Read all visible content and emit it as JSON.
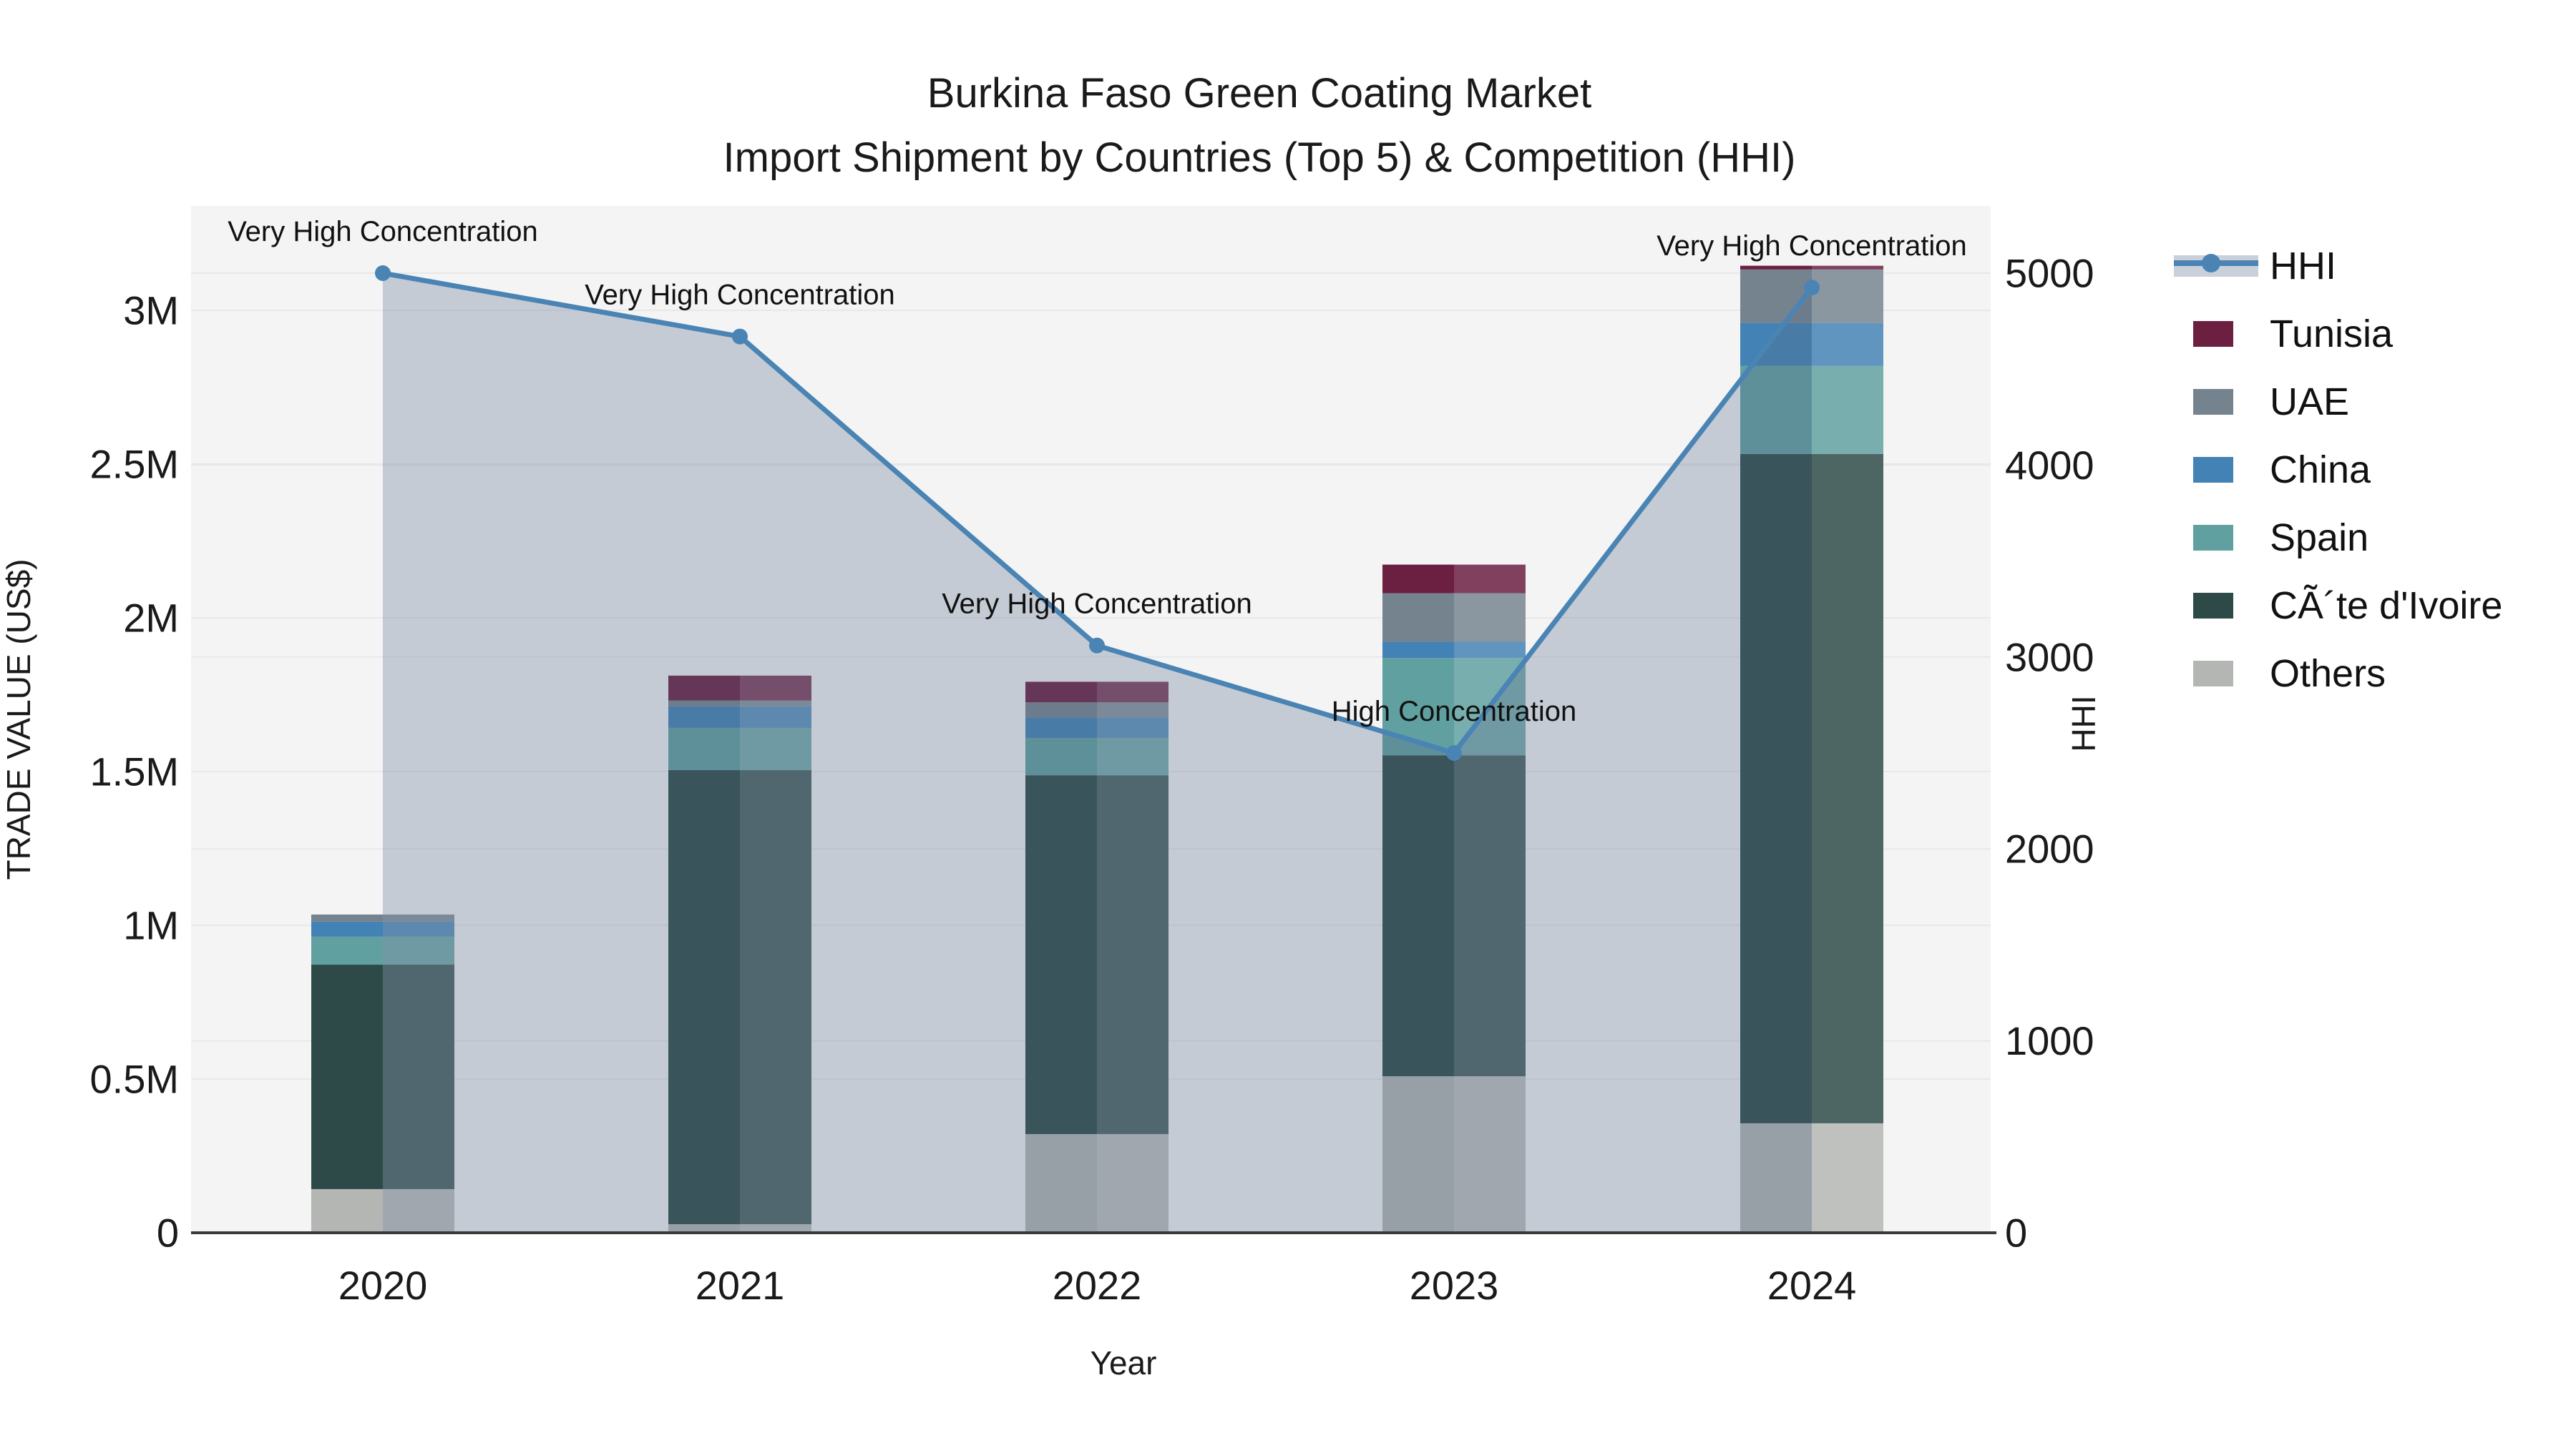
{
  "title": {
    "line1": "Burkina Faso Green Coating Market",
    "line2": "Import Shipment by Countries (Top 5) & Competition (HHI)"
  },
  "chart_data": {
    "type": "bar+line",
    "subtype": "stacked bars (trade value, left axis) with HHI line + area fill (right axis)",
    "categories": [
      "2020",
      "2021",
      "2022",
      "2023",
      "2024"
    ],
    "unit": "US$ millions",
    "stack_order_bottom_to_top": [
      "Others",
      "CÃ´te d'Ivoire",
      "Spain",
      "China",
      "UAE",
      "Tunisia"
    ],
    "series": [
      {
        "name": "Tunisia",
        "color": "#6b1f41",
        "values": [
          0,
          0.081,
          0.067,
          0.093,
          0.012
        ]
      },
      {
        "name": "UAE",
        "color": "#75838f",
        "values": [
          0.023,
          0.019,
          0.049,
          0.158,
          0.174
        ]
      },
      {
        "name": "China",
        "color": "#4382b4",
        "values": [
          0.049,
          0.07,
          0.067,
          0.053,
          0.14
        ]
      },
      {
        "name": "Spain",
        "color": "#61a0a0",
        "values": [
          0.091,
          0.137,
          0.121,
          0.316,
          0.286
        ]
      },
      {
        "name": "CÃ´te d'Ivoire",
        "color": "#2d4a48",
        "values": [
          0.73,
          1.477,
          1.167,
          1.044,
          2.177
        ]
      },
      {
        "name": "Others",
        "color": "#b4b6b4",
        "values": [
          0.142,
          0.028,
          0.321,
          0.509,
          0.356
        ]
      }
    ],
    "bar_totals": [
      1.035,
      1.812,
      1.792,
      2.173,
      3.145
    ],
    "line_series": {
      "name": "HHI",
      "color": "#4a84b4",
      "fill_color": "rgba(90,110,140,0.30)",
      "values": [
        5000,
        4670,
        3060,
        2500,
        4925
      ]
    },
    "annotations": [
      {
        "year": "2020",
        "text": "Very High Concentration"
      },
      {
        "year": "2021",
        "text": "Very High Concentration"
      },
      {
        "year": "2022",
        "text": "Very High Concentration"
      },
      {
        "year": "2023",
        "text": "High Concentration"
      },
      {
        "year": "2024",
        "text": "Very High Concentration"
      }
    ],
    "y_left": {
      "title": "TRADE VALUE (US$)",
      "tick_labels": [
        "0",
        "0.5M",
        "1M",
        "1.5M",
        "2M",
        "2.5M",
        "3M"
      ],
      "tick_values": [
        0,
        0.5,
        1,
        1.5,
        2,
        2.5,
        3
      ],
      "range": [
        0,
        3.34
      ]
    },
    "y_right": {
      "title": "HHI",
      "tick_labels": [
        "0",
        "1000",
        "2000",
        "3000",
        "4000",
        "5000"
      ],
      "tick_values": [
        0,
        1000,
        2000,
        3000,
        4000,
        5000
      ],
      "range": [
        0,
        5350
      ]
    },
    "x": {
      "title": "Year"
    },
    "grid": "on",
    "legend_position": "right"
  },
  "legend": {
    "items": [
      {
        "label": "HHI",
        "type": "line",
        "color": "#4a84b4"
      },
      {
        "label": "Tunisia",
        "type": "swatch",
        "color": "#6b1f41"
      },
      {
        "label": "UAE",
        "type": "swatch",
        "color": "#75838f"
      },
      {
        "label": "China",
        "type": "swatch",
        "color": "#4382b4"
      },
      {
        "label": "Spain",
        "type": "swatch",
        "color": "#61a0a0"
      },
      {
        "label": "CÃ´te d'Ivoire",
        "type": "swatch",
        "color": "#2d4a48"
      },
      {
        "label": "Others",
        "type": "swatch",
        "color": "#b4b6b4"
      }
    ]
  },
  "colors": {
    "plot_background": "#f4f4f4",
    "gridline": "#e8e8e8",
    "axis_line": "#3a3a3a",
    "text": "#1a1a1a",
    "annotation_text": "#111111"
  }
}
